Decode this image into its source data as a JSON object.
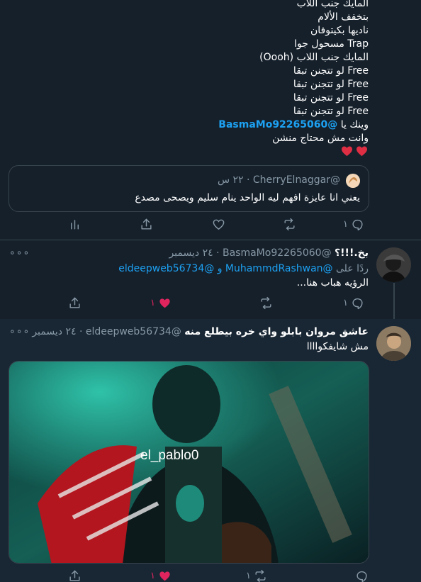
{
  "tweet1": {
    "lines": [
      "المايك جنب اللاب",
      "بتخفف الألام",
      "ناديها بكيتوفان",
      "Trap مسحول جوا",
      "المايك جنب اللاب (Oooh)",
      "Free لو تتجنن تبقا",
      "Free لو تتجنن تبقا",
      "Free لو تتجنن تبقا",
      "Free لو تتجنن تبقا"
    ],
    "line10_prefix": "وينك يا",
    "line10_mention": "@BasmaMo92265060",
    "line11": "وانت مش محتاج منشن",
    "quote": {
      "handle": "@CherryElnaggar",
      "time": "٢٢ س",
      "text": "يعني انا عايزة افهم ليه الواحد ينام سليم ويصحى مصدع"
    },
    "reply_count": "١"
  },
  "tweet2": {
    "name": "بخ.!!!؟",
    "handle": "@BasmaMo92265060",
    "date": "٢٤ ديسمبر",
    "reply_to_prefix": "ردًا على",
    "reply_to_user1": "@MuhammdRashwan",
    "reply_to_and": "و",
    "reply_to_user2": "@eldeepweb56734",
    "text": "الرؤيه هباب هنا...",
    "reply_count": "١",
    "like_count": "١"
  },
  "tweet3": {
    "name": "عاشق مروان بابلو واي خره بيطلع منه",
    "handle": "@eldeepweb56734",
    "date": "٢٤ ديسمبر",
    "text": "مش شايفكواااا",
    "image_watermark": "el_pablo0",
    "retweet_count": "١",
    "like_count": "١"
  },
  "separator": "·",
  "colors": {
    "background": "#15202b",
    "accent": "#1da1f2",
    "muted": "#8899a6",
    "like": "#e0245e",
    "border": "#38444d"
  }
}
